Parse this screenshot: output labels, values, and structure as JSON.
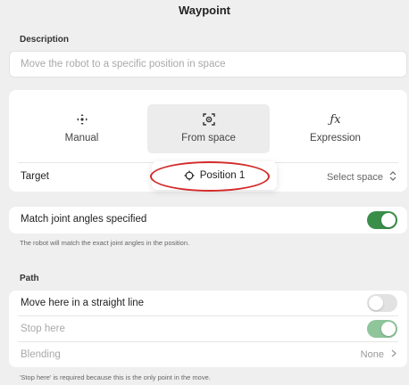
{
  "header": {
    "title": "Waypoint"
  },
  "description": {
    "label": "Description",
    "placeholder": "Move the robot to a specific position in space"
  },
  "mode_tabs": [
    {
      "label": "Manual",
      "icon": "move-arrows-icon",
      "active": false
    },
    {
      "label": "From space",
      "icon": "target-frame-icon",
      "active": true
    },
    {
      "label": "Expression",
      "icon": "function-fx-icon",
      "active": false
    }
  ],
  "target": {
    "label": "Target",
    "selected": "Position 1",
    "select_space_label": "Select space"
  },
  "match_joint": {
    "label": "Match joint angles specified",
    "enabled": true,
    "hint": "The robot will match the exact joint angles in the position."
  },
  "path": {
    "label": "Path",
    "straight_line": {
      "label": "Move here in a straight line",
      "enabled": false
    },
    "stop_here": {
      "label": "Stop here",
      "enabled": true
    },
    "blending": {
      "label": "Blending",
      "value": "None"
    },
    "hint": "'Stop here' is required because this is the only point in the move."
  },
  "colors": {
    "accent": "#3b8e4a",
    "annotation": "#d42a2a"
  }
}
